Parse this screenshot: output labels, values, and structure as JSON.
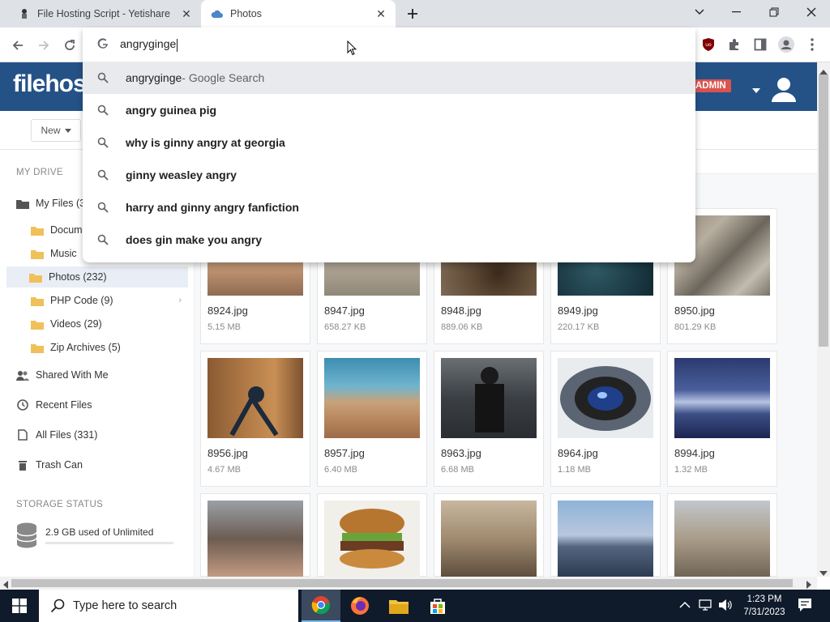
{
  "browser": {
    "tabs": [
      {
        "title": "File Hosting Script - Yetishare",
        "favicon": "yetishare-favicon-icon"
      },
      {
        "title": "Photos",
        "favicon": "cloud-favicon-icon"
      }
    ],
    "new_tab_icon": "plus-icon",
    "window_controls": [
      "tab-search-icon",
      "minimize-icon",
      "restore-icon",
      "close-icon"
    ]
  },
  "omnibox": {
    "value": "angryginge",
    "suggestions": [
      {
        "text": "angryginge",
        "suffix": " - Google Search",
        "bold": false
      },
      {
        "text": "angry guinea pig",
        "suffix": "",
        "bold": true
      },
      {
        "text": "why is ginny angry at georgia",
        "suffix": "",
        "bold": true
      },
      {
        "text": "ginny weasley angry",
        "suffix": "",
        "bold": true
      },
      {
        "text": "harry and ginny angry fanfiction",
        "suffix": "",
        "bold": true
      },
      {
        "text": "does gin make you angry",
        "suffix": "",
        "bold": true
      }
    ]
  },
  "site": {
    "logo": "filehos",
    "badge": "ADMIN",
    "new_button": "New",
    "brand_color": "#245287"
  },
  "sidebar": {
    "my_drive_heading": "MY DRIVE",
    "my_files": "My Files (3",
    "folders": [
      "Docum",
      "Music",
      "Photos (232)",
      "PHP Code (9)",
      "Videos (29)",
      "Zip Archives (5)"
    ],
    "shared": "Shared With Me",
    "recent": "Recent Files",
    "all_files": "All Files (331)",
    "trash": "Trash Can",
    "storage_heading": "STORAGE STATUS",
    "storage_text": "2.9 GB used of Unlimited"
  },
  "files": [
    {
      "name": "8924.jpg",
      "size": "5.15 MB"
    },
    {
      "name": "8947.jpg",
      "size": "658.27 KB"
    },
    {
      "name": "8948.jpg",
      "size": "889.06 KB"
    },
    {
      "name": "8949.jpg",
      "size": "220.17 KB"
    },
    {
      "name": "8950.jpg",
      "size": "801.29 KB"
    },
    {
      "name": "8956.jpg",
      "size": "4.67 MB"
    },
    {
      "name": "8957.jpg",
      "size": "6.40 MB"
    },
    {
      "name": "8963.jpg",
      "size": "6.68 MB"
    },
    {
      "name": "8964.jpg",
      "size": "1.18 MB"
    },
    {
      "name": "8994.jpg",
      "size": "1.32 MB"
    }
  ],
  "taskbar": {
    "search_placeholder": "Type here to search",
    "time": "1:23 PM",
    "date": "7/31/2023"
  }
}
